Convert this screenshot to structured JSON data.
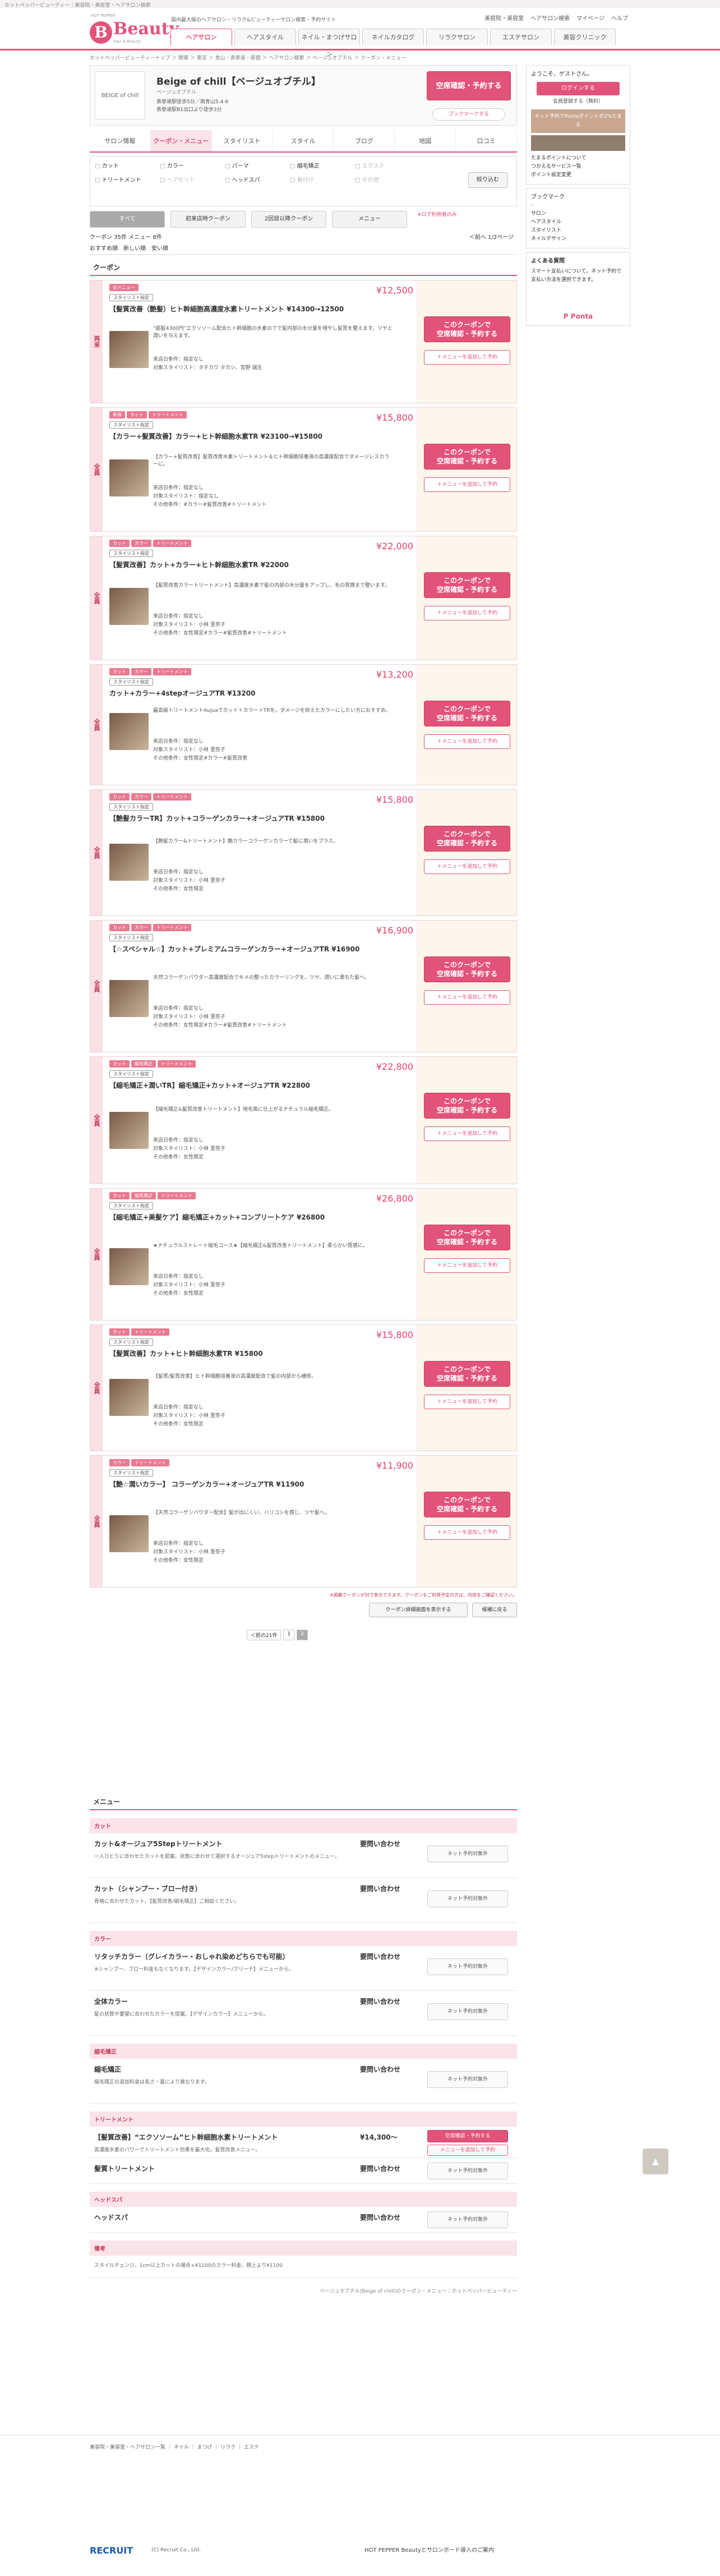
{
  "topbar": "ホットペッパービューティー｜美容院・美容室・ヘアサロン検索",
  "logo": {
    "small": "HOT PEPPER",
    "main": "Beauty",
    "sub": "Hair & Beauty"
  },
  "header": {
    "note": "国内最大級のヘアサロン・リラク&ビューティーサロン検索・予約サイト",
    "links": [
      "美容院・美容室",
      "ヘアサロン検索",
      "マイページ",
      "ヘルプ"
    ]
  },
  "gnav": [
    "ヘアサロン",
    "ヘアスタイル",
    "ネイル・まつげサロン",
    "ネイルカタログ",
    "リラクサロン",
    "エステサロン",
    "美容クリニック"
  ],
  "breadcrumb": "ホットペッパービューティートップ ＞ 関東 ＞ 東京 ＞ 青山・表参道・原宿 ＞ ヘアサロン検索 ＞ ベージュオブチル ＞ クーポン・メニュー",
  "salon": {
    "name": "Beige of chill【ベージュオブチル】",
    "kana": "ベージュオブチル",
    "address": "表参道駅徒歩5分／南青山5-4-6",
    "access": "表参道駅B1出口より徒歩3分",
    "reserve": "空席確認・予約する",
    "bookmark": "ブックマークする",
    "photo": "BEIGE of chill"
  },
  "tabs": [
    "サロン情報",
    "クーポン・メニュー",
    "スタイリスト",
    "スタイル",
    "ブログ",
    "地図",
    "口コミ"
  ],
  "filter": {
    "items": [
      "カット",
      "カラー",
      "パーマ",
      "縮毛矯正",
      "エクステ",
      "トリートメント",
      "ヘアセット",
      "ヘッドスパ",
      "着付け",
      "その他"
    ],
    "disabled": [
      4,
      6,
      8,
      9
    ],
    "go": "絞り込む"
  },
  "coupon_buttons": [
    "すべて",
    "初来店時クーポン",
    "2回目以降クーポン",
    "メニュー"
  ],
  "coupon_note": "※ログ利用者のみ",
  "counts": {
    "text": "クーポン 35件 メニュー 8件",
    "paging": "＜前へ 1/2ページ"
  },
  "sort": "おすすめ順　新しい順　安い順",
  "coupon_title": "クーポン",
  "coupons": [
    {
      "label": "再来",
      "tags": [
        "全メニュー"
      ],
      "title": "【髪質改善（艶髪）ヒト幹細胞高濃度水素トリートメント ¥14300→12500",
      "price": "¥12,500",
      "desc": "“超髪4300円”エクソソーム配合ヒト幹細胞の水素のでで髪内部の水分量を増やし髪質を整えます。ツヤと潤いを与えます。",
      "m1": "来店日条件：指定なし",
      "m2": "対象スタイリスト：タチカワ タカシ、宮野 瑞生"
    },
    {
      "label": "全員",
      "tags": [
        "新規",
        "カット",
        "トリートメント"
      ],
      "title": "【カラー+髪質改善】カラー+ヒト幹細胞水素TR ¥23100→¥15800",
      "price": "¥15,800",
      "desc": "【カラー+髪質改善】髪質改善水素トリートメント＆ヒト幹細胞培養液の高濃度配合でダメージレスカラーに。",
      "m1": "来店日条件：指定なし",
      "m2": "対象スタイリスト：指定なし",
      "m3": "その他条件：#カラー#髪質改善#トリートメント"
    },
    {
      "label": "全員",
      "tags": [
        "カット",
        "カラー",
        "トリートメント"
      ],
      "title": "【髪質改善】カット+カラー+ヒト幹細胞水素TR ¥22000",
      "price": "¥22,000",
      "desc": "【髪質改善カラートリートメント】高濃度水素で髪の内部の水分量をアップし、毛の質感まで整います。",
      "m1": "来店日条件：指定なし",
      "m2": "対象スタイリスト：小林 里奈子",
      "m3": "その他条件：女性限定#カラー#髪質改善#トリートメント"
    },
    {
      "label": "全員",
      "tags": [
        "カット",
        "カラー",
        "トリートメント"
      ],
      "title": "カット+カラー+4stepオージュアTR ¥13200",
      "price": "¥13,200",
      "desc": "最高級トリートメントAujuaでカット＋カラー＋TRを。ダメージを抑えたカラーにしたい方におすすめ。",
      "m1": "来店日条件：指定なし",
      "m2": "対象スタイリスト：小林 里奈子",
      "m3": "その他条件：女性限定#カラー#髪質改善"
    },
    {
      "label": "全員",
      "tags": [
        "カット",
        "カラー",
        "トリートメント"
      ],
      "title": "【艶髪カラーTR】カット+コラーゲンカラー+オージュアTR ¥15800",
      "price": "¥15,800",
      "desc": "【艶髪カラー&トリートメント】艶カラーコラーゲンカラーで髪に潤いをプラス。",
      "m1": "来店日条件：指定なし",
      "m2": "対象スタイリスト：小林 里奈子",
      "m3": "その他条件：女性限定"
    },
    {
      "label": "全員",
      "tags": [
        "カット",
        "カラー",
        "トリートメント"
      ],
      "title": "【☆スペシャル☆】カット+プレミアムコラーゲンカラー+オージュアTR ¥16900",
      "price": "¥16,900",
      "desc": "天然コラーゲンパウダー高濃度配合でキメの整ったカラーリングを。ツヤ、潤いに満ちた髪へ。",
      "m1": "来店日条件：指定なし",
      "m2": "対象スタイリスト：小林 里奈子",
      "m3": "その他条件：女性限定#カラー#髪質改善#トリートメント"
    },
    {
      "label": "全員",
      "tags": [
        "カット",
        "縮毛矯正",
        "トリートメント"
      ],
      "title": "【縮毛矯正+潤いTR】縮毛矯正+カット+オージュアTR ¥22800",
      "price": "¥22,800",
      "desc": "【縮毛矯正&髪質改善トリートメント】地毛風に仕上がるナチュラル縮毛矯正。",
      "m1": "来店日条件：指定なし",
      "m2": "対象スタイリスト：小林 里奈子",
      "m3": "その他条件：女性限定"
    },
    {
      "label": "全員",
      "tags": [
        "カット",
        "縮毛矯正",
        "トリートメント"
      ],
      "title": "【縮毛矯正+美髪ケア】縮毛矯正+カット+コンプリートケア ¥26800",
      "price": "¥26,800",
      "desc": "★ナチュラルストレート縮毛コース★【縮毛矯正&髪質改善トリートメント】柔らかい質感に。",
      "m1": "来店日条件：指定なし",
      "m2": "対象スタイリスト：小林 里奈子",
      "m3": "その他条件：女性限定"
    },
    {
      "label": "全員",
      "tags": [
        "カット",
        "トリートメント"
      ],
      "title": "【髪質改善】カット+ヒト幹細胞水素TR ¥15800",
      "price": "¥15,800",
      "desc": "【髪質/髪質改善】ヒト幹細胞培養液の高濃度配合で髪の内部から補修。",
      "m1": "来店日条件：指定なし",
      "m2": "対象スタイリスト：小林 里奈子",
      "m3": "その他条件：女性限定"
    },
    {
      "label": "全員",
      "tags": [
        "カラー",
        "トリートメント"
      ],
      "title": "【艶☆潤いカラー】 コラーゲンカラー+オージュアTR ¥11900",
      "price": "¥11,900",
      "desc": "【天然コラーゲンパウダー配合】髪が出にくい、ハリコシを感じ、ツヤ髪へ。",
      "m1": "来店日条件：指定なし",
      "m2": "対象スタイリスト：小林 里奈子",
      "m3": "その他条件：女性限定"
    }
  ],
  "list_note": "※掲載クーポンが対で表示できます。クーポンをご利用予定の方は、内容をご確認ください。",
  "list_buttons": [
    "クーポン詳細画面を表示する",
    "候補に戻る"
  ],
  "pager": {
    "prev": "＜前の21件",
    "pages": [
      "1",
      "2"
    ]
  },
  "menu": {
    "title": "メニュー",
    "cats": [
      {
        "name": "カット",
        "rows": [
          {
            "n": "カット&オージュア5Stepトリートメント",
            "p": "要問い合わせ",
            "d": "一人ひとりに合わせたカットを提案。状態に合わせて選択するオージュア5stepトリートメントのメニュー。"
          },
          {
            "n": "カット（シャンプー・ブロー付き）",
            "p": "要問い合わせ",
            "d": "骨格に合わせたカット。【髪質改善/縮毛矯正】ご相談ください。"
          }
        ]
      },
      {
        "name": "カラー",
        "rows": [
          {
            "n": "リタッチカラー（グレイカラー・おしゃれ染めどちらでも可能）",
            "p": "要問い合わせ",
            "d": "※シャンプー、ブロー料金もなくなります。【デザインカラー/ブリーチ】メニューから。"
          },
          {
            "n": "全体カラー",
            "p": "要問い合わせ",
            "d": "髪の状態や要望に合わせたカラーを提案。【デザインカラー】メニューから。"
          }
        ]
      },
      {
        "name": "縮毛矯正",
        "rows": [
          {
            "n": "縮毛矯正",
            "p": "要問い合わせ",
            "d": "縮毛矯正の追加料金は長さ・量により異なります。"
          }
        ]
      },
      {
        "name": "トリートメント",
        "rows": [
          {
            "n": "【髪質改善】“エクソソーム”ヒト幹細胞水素トリートメント",
            "p": "¥14,300〜",
            "d": "高濃度水素のパワーでトリートメント効果を最大化。髪質改善メニュー。"
          },
          {
            "n": "髪質トリートメント",
            "p": "要問い合わせ",
            "d": ""
          }
        ]
      },
      {
        "name": "ヘッドスパ",
        "rows": [
          {
            "n": "ヘッドスパ",
            "p": "要問い合わせ",
            "d": ""
          }
        ]
      },
      {
        "name": "備考",
        "rows": [
          {
            "n": "",
            "p": "",
            "d": "スタイルチェンジ、1cm以上カットの場合+¥1100のカラー料金、顔上より¥1100"
          }
        ]
      }
    ],
    "reserve_btn": "空席確認・予約する",
    "add_btn": "メニューを追加して予約",
    "net_btn": "ネット予約対象外"
  },
  "page_foot": "ベージュオブチル(Beige of chill)のクーポン・メニュー｜ホットペッパービューティー",
  "side": {
    "greet": "ようこそ、ゲストさん。",
    "login": "ログインする",
    "register": "会員登録する（無料）",
    "ponta": "ネット予約でPontaポイントが2%たまる",
    "links": [
      "たまるポイントについて",
      "つかえるサービス一覧",
      "ポイント設定変更"
    ],
    "bm_title": "ブックマーク",
    "bm_items": [
      "サロン",
      "ヘアスタイル",
      "スタイリスト",
      "ネイルデザイン"
    ],
    "faq_title": "よくある質問",
    "faq": "スマート支払いについて。ネット予約で支払い方法を選択できます。"
  },
  "footer": {
    "links": "美容院・美容室・ヘアサロン一覧 ｜ ネイル ｜ まつげ ｜ リラク ｜ エステ",
    "copy": "(C) Recruit Co., Ltd.",
    "recruit": "RECRUIT",
    "right": "HOT PEPPER Beautyとサロンボード導入のご案内"
  }
}
